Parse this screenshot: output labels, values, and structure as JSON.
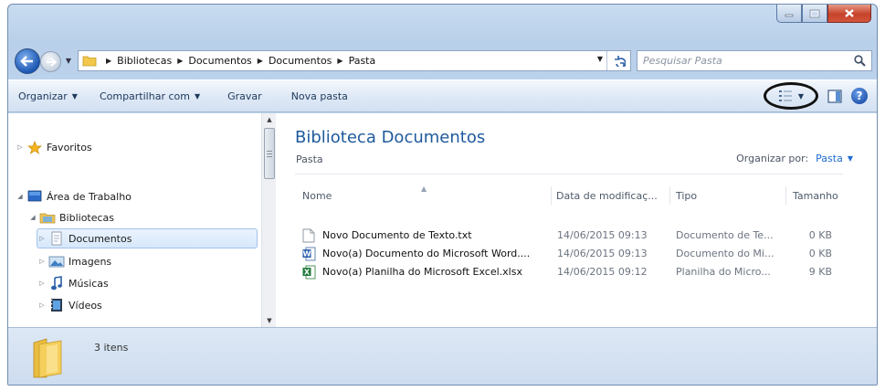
{
  "window": {
    "caption_buttons": [
      "minimize",
      "maximize",
      "close"
    ]
  },
  "address": {
    "breadcrumbs": [
      "Bibliotecas",
      "Documentos",
      "Documentos",
      "Pasta"
    ]
  },
  "search": {
    "placeholder": "Pesquisar Pasta"
  },
  "toolbar": {
    "organizar": "Organizar",
    "compartilhar": "Compartilhar com",
    "gravar": "Gravar",
    "nova_pasta": "Nova pasta"
  },
  "nav": {
    "favoritos": "Favoritos",
    "area_trabalho": "Área de Trabalho",
    "bibliotecas": "Bibliotecas",
    "documentos": "Documentos",
    "imagens": "Imagens",
    "musicas": "Músicas",
    "videos": "Vídeos"
  },
  "library": {
    "title": "Biblioteca Documentos",
    "subtitle": "Pasta",
    "arrange_label": "Organizar por:",
    "arrange_value": "Pasta"
  },
  "columns": {
    "name": "Nome",
    "date": "Data de modificaç...",
    "type": "Tipo",
    "size": "Tamanho"
  },
  "files": [
    {
      "name": "Novo Documento de Texto.txt",
      "date": "14/06/2015 09:13",
      "type": "Documento de Te...",
      "size": "0 KB",
      "icon": "text-file-icon"
    },
    {
      "name": "Novo(a) Documento do Microsoft Word....",
      "date": "14/06/2015 09:13",
      "type": "Documento do Mi...",
      "size": "0 KB",
      "icon": "word-file-icon"
    },
    {
      "name": "Novo(a) Planilha do Microsoft Excel.xlsx",
      "date": "14/06/2015 09:12",
      "type": "Planilha do Micro...",
      "size": "9 KB",
      "icon": "excel-file-icon"
    }
  ],
  "details": {
    "item_count": "3 itens"
  },
  "colors": {
    "title_blue": "#1e5a9c",
    "link_blue": "#1f6bcf",
    "toolbar_text": "#1e395b"
  }
}
